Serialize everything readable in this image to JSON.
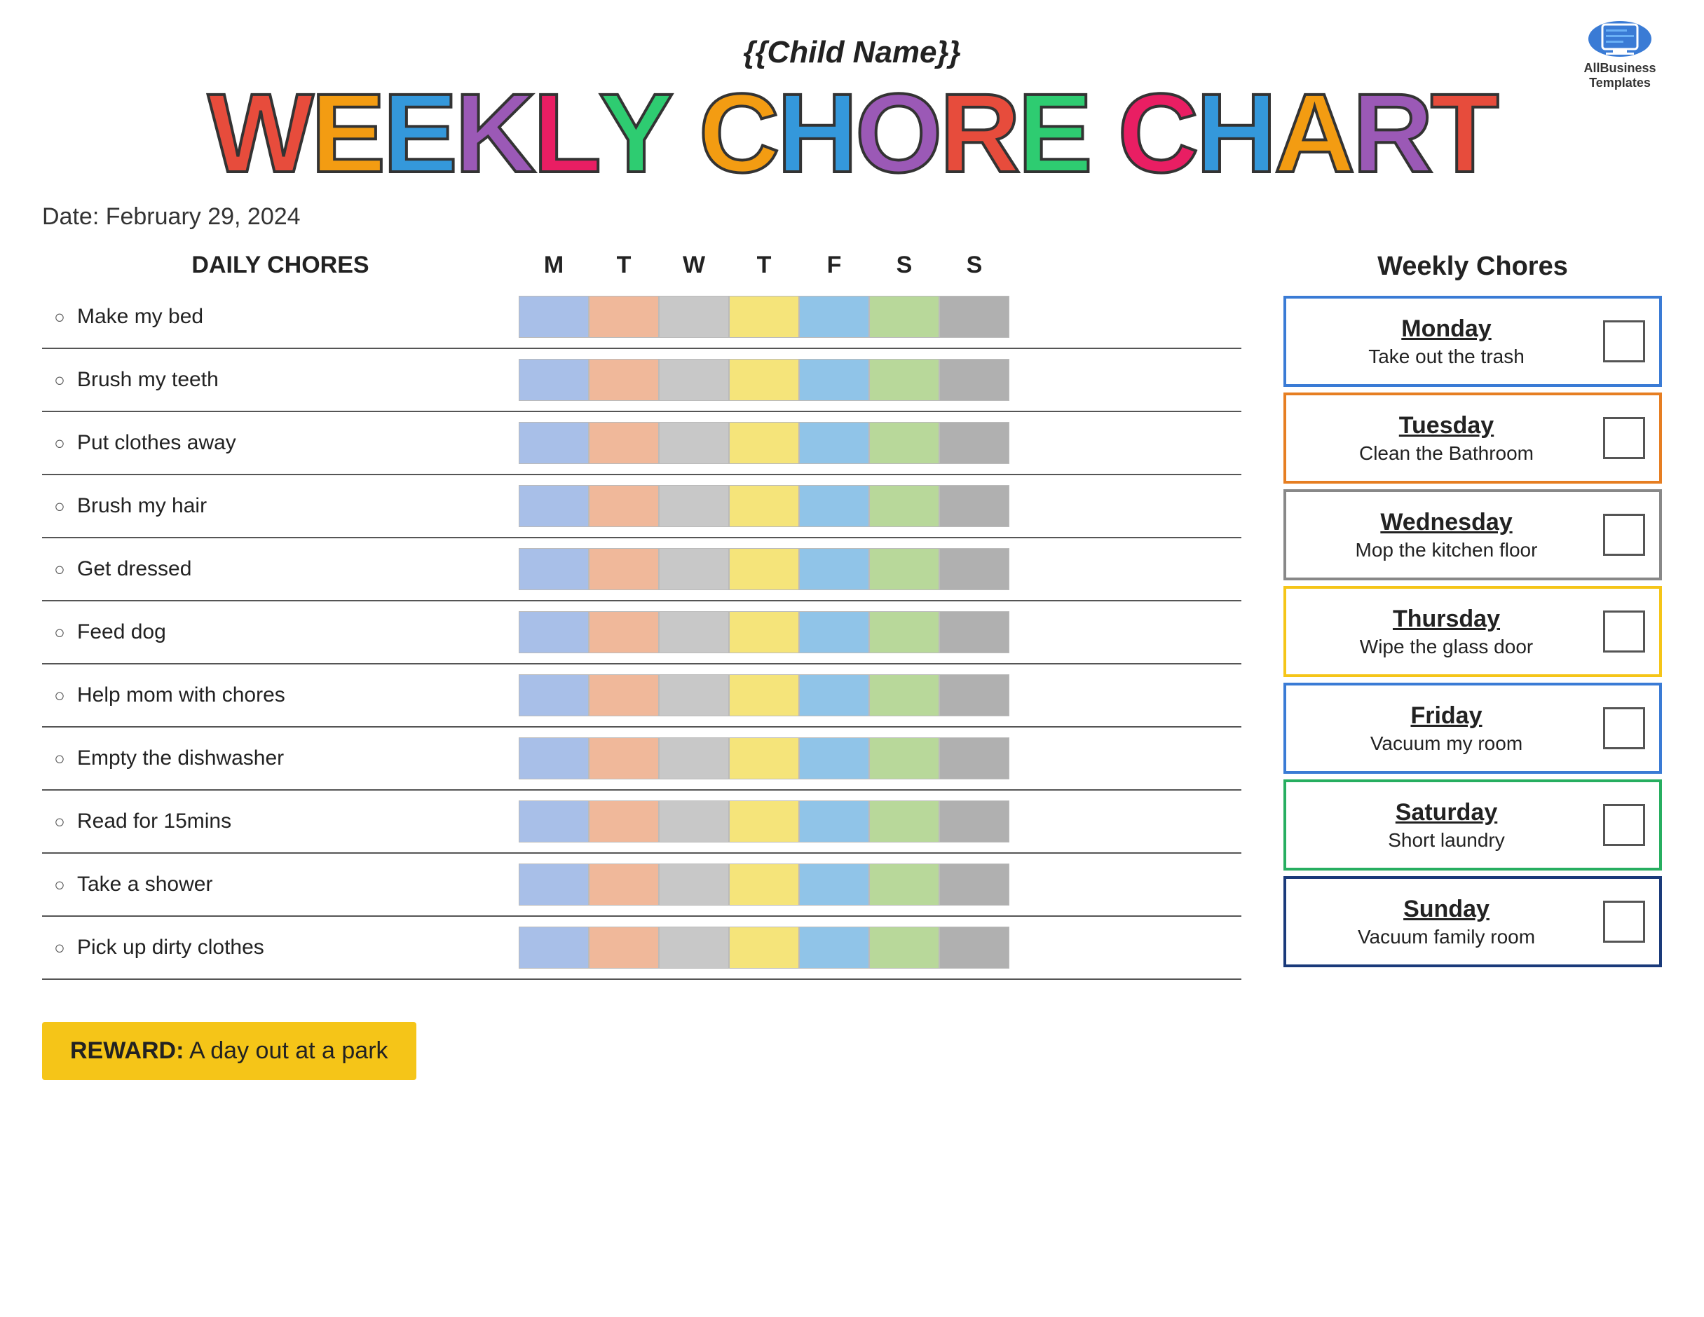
{
  "header": {
    "child_name": "{{Child Name}}",
    "title_word1": [
      "W",
      "E",
      "E",
      "K",
      "L",
      "Y"
    ],
    "title_word2": [
      "C",
      "H",
      "O",
      "R",
      "E"
    ],
    "title_word3": [
      "C",
      "H",
      "A",
      "R",
      "T"
    ],
    "date": "Date: February 29, 2024"
  },
  "chores_table": {
    "header_label": "DAILY CHORES",
    "day_letters": [
      "M",
      "T",
      "W",
      "T",
      "F",
      "S",
      "S"
    ],
    "chores": [
      "Make my bed",
      "Brush my teeth",
      "Put clothes away",
      "Brush my hair",
      "Get dressed",
      "Feed dog",
      "Help mom with chores",
      "Empty the dishwasher",
      "Read for 15mins",
      "Take a shower",
      "Pick up dirty clothes"
    ]
  },
  "reward": {
    "label": "REWARD:",
    "text": "A day out at a park"
  },
  "weekly_chores": {
    "title": "Weekly Chores",
    "items": [
      {
        "day": "Monday",
        "chore": "Take out the trash",
        "border": "blue"
      },
      {
        "day": "Tuesday",
        "chore": "Clean the Bathroom",
        "border": "orange"
      },
      {
        "day": "Wednesday",
        "chore": "Mop the kitchen floor",
        "border": "gray"
      },
      {
        "day": "Thursday",
        "chore": "Wipe the glass door",
        "border": "gold"
      },
      {
        "day": "Friday",
        "chore": "Vacuum my room",
        "border": "blue"
      },
      {
        "day": "Saturday",
        "chore": "Short laundry",
        "border": "green"
      },
      {
        "day": "Sunday",
        "chore": "Vacuum family room",
        "border": "navy"
      }
    ]
  },
  "logo": {
    "line1": "AllBusiness",
    "line2": "Templates"
  }
}
